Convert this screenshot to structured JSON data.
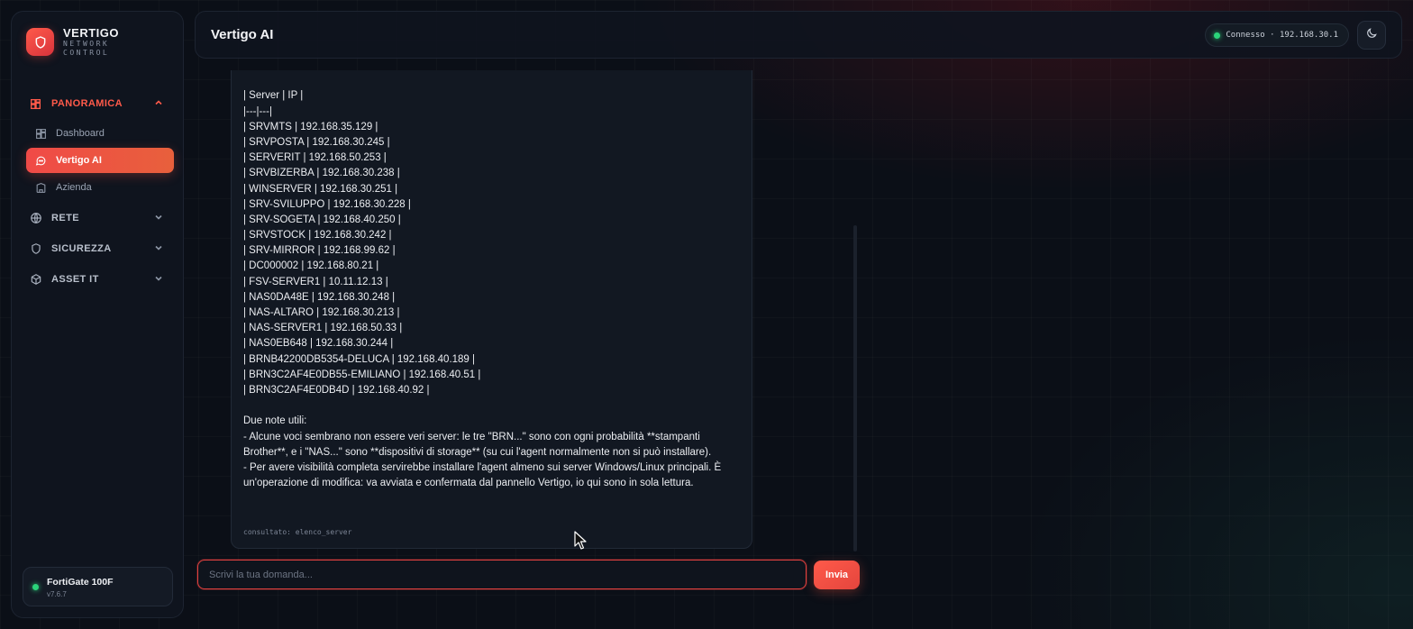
{
  "brand": {
    "name": "VERTIGO",
    "subtitle_line1": "NETWORK",
    "subtitle_line2": "CONTROL"
  },
  "sidebar": {
    "groups": [
      {
        "label": "PANORAMICA",
        "icon": "dashboard-grid-icon",
        "expanded": true,
        "items": [
          {
            "label": "Dashboard",
            "icon": "grid-icon",
            "active": false
          },
          {
            "label": "Vertigo AI",
            "icon": "chat-bubble-icon",
            "active": true
          },
          {
            "label": "Azienda",
            "icon": "building-icon",
            "active": false
          }
        ]
      },
      {
        "label": "RETE",
        "icon": "globe-icon",
        "expanded": false
      },
      {
        "label": "SICUREZZA",
        "icon": "shield-icon",
        "expanded": false
      },
      {
        "label": "ASSET IT",
        "icon": "cube-icon",
        "expanded": false
      }
    ],
    "device": {
      "name": "FortiGate 100F",
      "version": "v7.6.7"
    }
  },
  "header": {
    "title": "Vertigo AI",
    "connection": "Connesso · 192.168.30.1"
  },
  "chat": {
    "message_lines": [
      "| Server | IP |",
      "|---|---|",
      "| SRVMTS | 192.168.35.129 |",
      "| SRVPOSTA | 192.168.30.245 |",
      "| SERVERIT | 192.168.50.253 |",
      "| SRVBIZERBA | 192.168.30.238 |",
      "| WINSERVER | 192.168.30.251 |",
      "| SRV-SVILUPPO | 192.168.30.228 |",
      "| SRV-SOGETA | 192.168.40.250 |",
      "| SRVSTOCK | 192.168.30.242 |",
      "| SRV-MIRROR | 192.168.99.62 |",
      "| DC000002 | 192.168.80.21 |",
      "| FSV-SERVER1 | 10.11.12.13 |",
      "| NAS0DA48E | 192.168.30.248 |",
      "| NAS-ALTARO | 192.168.30.213 |",
      "| NAS-SERVER1 | 192.168.50.33 |",
      "| NAS0EB648 | 192.168.30.244 |",
      "| BRNB42200DB5354-DELUCA | 192.168.40.189 |",
      "| BRN3C2AF4E0DB55-EMILIANO | 192.168.40.51 |",
      "| BRN3C2AF4E0DB4D | 192.168.40.92 |"
    ],
    "notes_heading": "Due note utili:",
    "note_1": "- Alcune voci sembrano non essere veri server: le tre \"BRN...\" sono con ogni probabilità **stampanti Brother**, e i \"NAS...\" sono **dispositivi di storage** (su cui l'agent normalmente non si può installare).",
    "note_2": "- Per avere visibilità completa servirebbe installare l'agent almeno sui server Windows/Linux principali. È un'operazione di modifica: va avviata e confermata dal pannello Vertigo, io qui sono in sola lettura.",
    "consulted": "consultato: elenco_server",
    "input_placeholder": "Scrivi la tua domanda...",
    "input_value": "",
    "send_label": "Invia"
  },
  "colors": {
    "accent": "#f04a47",
    "online": "#2bd47a",
    "background": "#0b0f17"
  }
}
